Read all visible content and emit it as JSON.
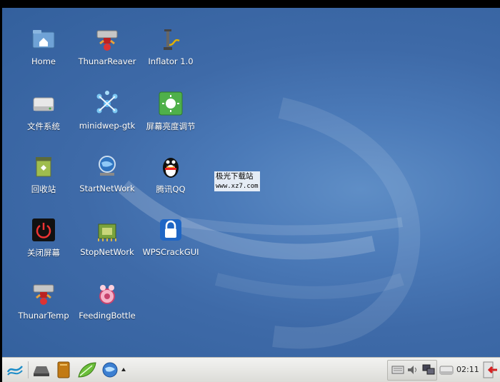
{
  "desktop": {
    "icons": [
      {
        "label": "Home",
        "icon": "home-folder-icon"
      },
      {
        "label": "ThunarReaver",
        "icon": "bomb-tool-icon"
      },
      {
        "label": "Inflator 1.0",
        "icon": "air-pump-icon"
      },
      {
        "label": "文件系统",
        "icon": "drive-icon"
      },
      {
        "label": "minidwep-gtk",
        "icon": "network-star-icon"
      },
      {
        "label": "屏幕亮度调节",
        "icon": "brightness-icon"
      },
      {
        "label": "回收站",
        "icon": "trash-icon"
      },
      {
        "label": "StartNetWork",
        "icon": "network-globe-icon"
      },
      {
        "label": "腾讯QQ",
        "icon": "qq-penguin-icon"
      },
      {
        "label": "关闭屏幕",
        "icon": "power-icon"
      },
      {
        "label": "StopNetWork",
        "icon": "network-card-icon"
      },
      {
        "label": "WPSCrackGUI",
        "icon": "wps-lock-icon"
      },
      {
        "label": "ThunarTemp",
        "icon": "bomb-tool-icon"
      },
      {
        "label": "FeedingBottle",
        "icon": "feeding-bottle-icon"
      }
    ],
    "watermark": {
      "line1": "极光下载站",
      "line2": "www.xz7.com"
    }
  },
  "taskbar": {
    "launchers": [
      "menu-icon",
      "drive-icon",
      "book-icon",
      "leaf-icon",
      "globe-icon",
      "expand-arrow-icon"
    ],
    "tray": [
      "keyboard-icon",
      "volume-icon",
      "network-icon"
    ],
    "clock": "02:11"
  }
}
